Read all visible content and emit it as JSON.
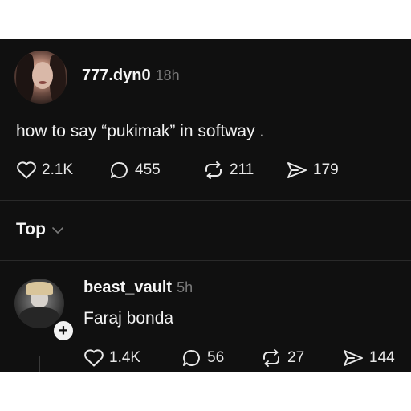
{
  "post": {
    "username": "777.dyn0",
    "time": "18h",
    "text": "how to say “pukimak” in softway .",
    "stats": {
      "likes": "2.1K",
      "comments": "455",
      "reposts": "211",
      "shares": "179"
    }
  },
  "sort": {
    "label": "Top"
  },
  "reply": {
    "username": "beast_vault",
    "time": "5h",
    "text": "Faraj bonda",
    "stats": {
      "likes": "1.4K",
      "comments": "56",
      "reposts": "27",
      "shares": "144"
    }
  },
  "icons": {
    "like": "heart-icon",
    "comment": "comment-bubble-icon",
    "repost": "repost-icon",
    "share": "send-icon",
    "sort": "chevron-down-icon",
    "follow": "plus-icon"
  },
  "colors": {
    "background": "#101010",
    "text": "#f3f3f3",
    "muted": "#7a7a7a"
  }
}
